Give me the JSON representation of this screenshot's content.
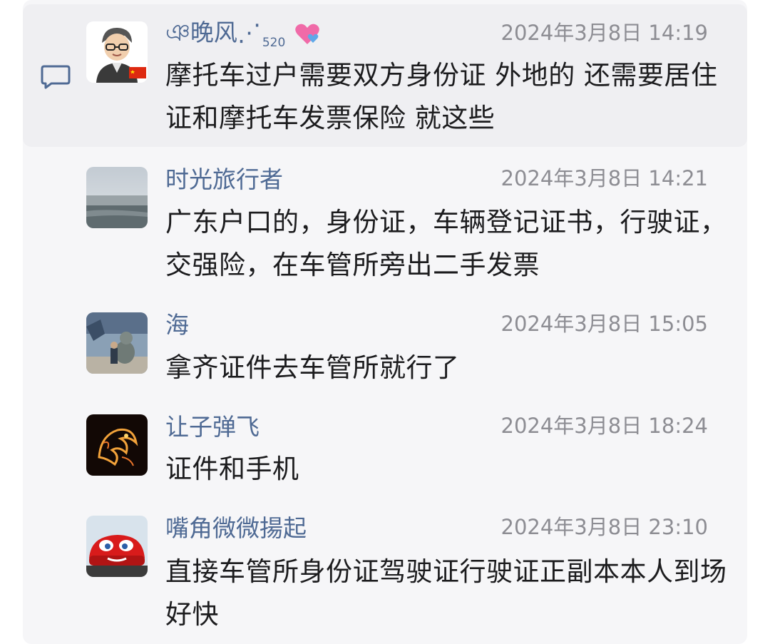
{
  "comments": [
    {
      "username": "ঞ晚风⋰",
      "username_suffix": "520",
      "timestamp": "2024年3月8日 14:19",
      "text": "摩托车过户需要双方身份证 外地的 还需要居住证和摩托车发票保险 就这些",
      "avatar": "cartoon-man-avatar"
    },
    {
      "username": "时光旅行者",
      "timestamp": "2024年3月8日 14:21",
      "text": "广东户口的，身份证，车辆登记证书，行驶证，交强险，在车管所旁出二手发票",
      "avatar": "seaside-photo-avatar"
    },
    {
      "username": "海",
      "timestamp": "2024年3月8日 15:05",
      "text": "拿齐证件去车管所就行了",
      "avatar": "dog-statue-avatar"
    },
    {
      "username": "让子弹飞",
      "timestamp": "2024年3月8日 18:24",
      "text": "证件和手机",
      "avatar": "fire-dragon-avatar"
    },
    {
      "username": "嘴角微微揚起",
      "timestamp": "2024年3月8日 23:10",
      "text": "直接车管所身份证驾驶证行驶证正副本本人到场好快",
      "avatar": "red-race-car-avatar"
    }
  ],
  "colors": {
    "username": "#4f6a94",
    "timestamp": "#8d8d93",
    "text": "#1c1c1e",
    "highlight": "#efeff2"
  }
}
